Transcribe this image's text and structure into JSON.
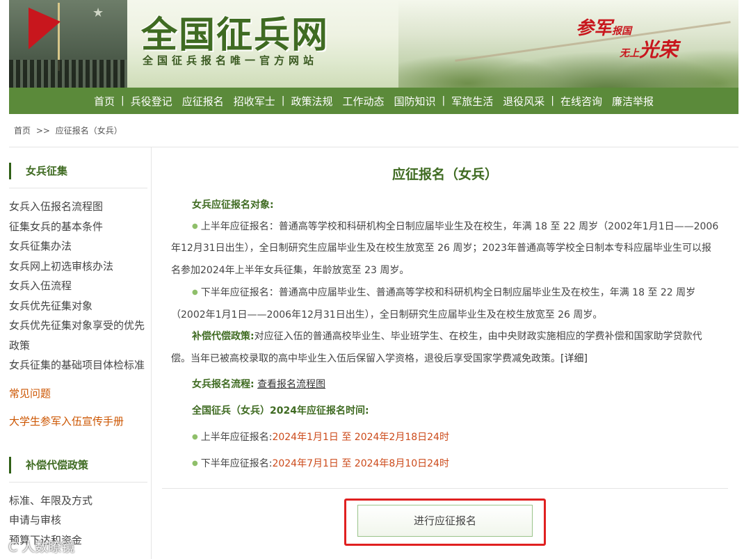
{
  "banner": {
    "title": "全国征兵网",
    "subtitle": "全国征兵报名唯一官方网站",
    "slogan_a": "参军",
    "slogan_b": "报国",
    "slogan_c": "无上",
    "slogan_d": "光荣"
  },
  "nav": {
    "items": [
      "首页",
      "兵役登记",
      "应征报名",
      "招收军士",
      "政策法规",
      "工作动态",
      "国防知识",
      "军旅生活",
      "退役风采",
      "在线咨询",
      "廉洁举报"
    ],
    "separator": "|"
  },
  "breadcrumb": {
    "home": "首页",
    "arrow": ">>",
    "current": "应征报名（女兵）"
  },
  "sidebar": {
    "section1_title": "女兵征集",
    "items": [
      "女兵入伍报名流程图",
      "征集女兵的基本条件",
      "女兵征集办法",
      "女兵网上初选审核办法",
      "女兵入伍流程",
      "女兵优先征集对象",
      "女兵优先征集对象享受的优先政策",
      "女兵征集的基础项目体检标准"
    ],
    "faq": "常见问题",
    "handbook": "大学生参军入伍宣传手册",
    "section2_title": "补偿代偿政策",
    "items2": [
      "标准、年限及方式",
      "申请与审核",
      "预算下达和资金"
    ]
  },
  "main": {
    "title": "应征报名（女兵）",
    "target_label": "女兵应征报名对象:",
    "first_half": "上半年应征报名：普通高等学校和科研机构全日制应届毕业生及在校生，年满 18 至 22 周岁（2002年1月1日——2006年12月31日出生），全日制研究生应届毕业生及在校生放宽至 26 周岁；2023年普通高等学校全日制本专科应届毕业生可以报名参加2024年上半年女兵征集，年龄放宽至 23 周岁。",
    "second_half": "下半年应征报名：普通高中应届毕业生、普通高等学校和科研机构全日制应届毕业生及在校生，年满 18 至 22 周岁（2002年1月1日——2006年12月31日出生），全日制研究生应届毕业生及在校生放宽至 26 周岁。",
    "comp_label": "补偿代偿政策:",
    "comp_text": "对应征入伍的普通高校毕业生、毕业班学生、在校生，由中央财政实施相应的学费补偿和国家助学贷款代偿。当年已被高校录取的高中毕业生入伍后保留入学资格，退役后享受国家学费减免政策。",
    "comp_link": "[详细]",
    "process_label": "女兵报名流程:",
    "process_link": "查看报名流程图",
    "time_label": "全国征兵（女兵）2024年应征报名时间:",
    "time1_prefix": "上半年应征报名:",
    "time1_value": "2024年1月1日 至 2024年2月18日24时",
    "time2_prefix": "下半年应征报名:",
    "time2_value": "2024年7月1日 至 2024年8月10日24时",
    "button": "进行应征报名"
  },
  "watermark": "C 人数瞭镜",
  "colors": {
    "nav_green": "#5b8a3a",
    "title_green": "#3f6b22",
    "date_red": "#cc4a1a",
    "highlight_red": "#e02020"
  }
}
